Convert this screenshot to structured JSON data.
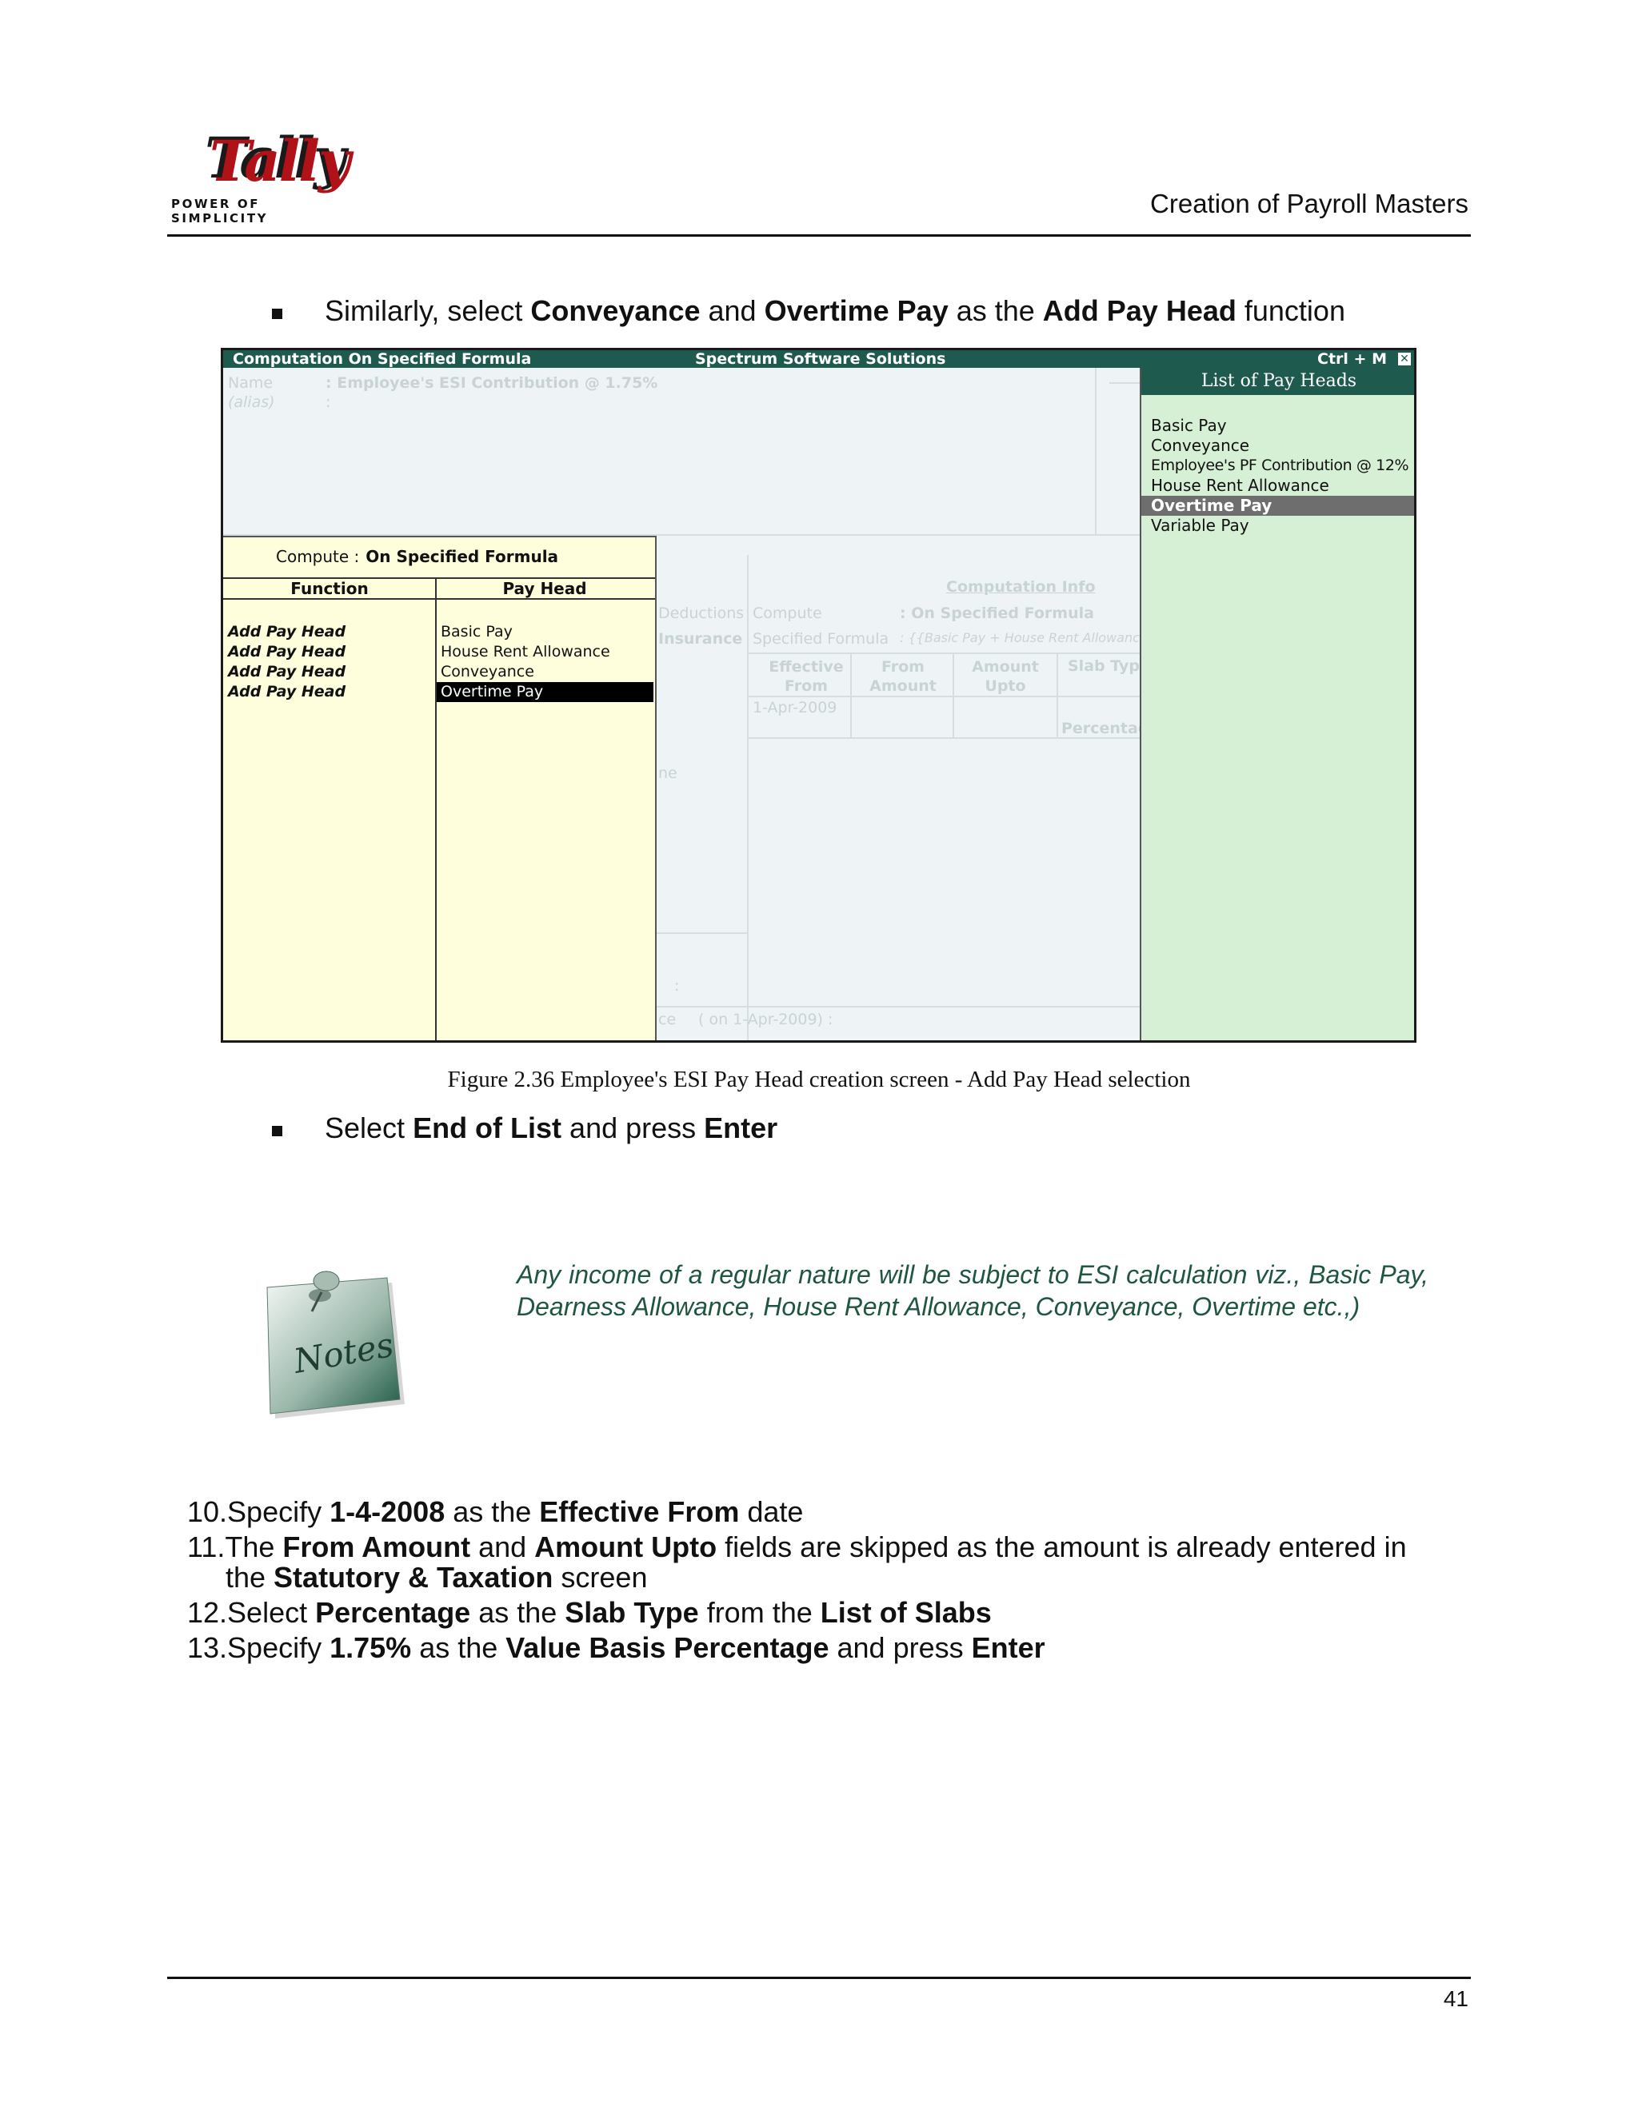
{
  "header": {
    "logo_word": "Tally",
    "logo_tagline": "POWER OF SIMPLICITY",
    "chapter_title": "Creation of Payroll Masters"
  },
  "bullet1": {
    "t1": "Similarly, select ",
    "b1": "Conveyance",
    "t2": " and ",
    "b2": "Overtime Pay",
    "t3": " as the ",
    "b3": "Add Pay Head",
    "t4": " function"
  },
  "screenshot": {
    "title_left": "Computation On Specified Formula",
    "title_center": "Spectrum Software Solutions",
    "title_right": "Ctrl + M",
    "close_glyph": "✕",
    "background": {
      "name_label": "Name",
      "name_value": ":  Employee's ESI Contribution @ 1.75%",
      "alias_label": "(alias)",
      "alias_colon": ":",
      "deductions": "Deductions",
      "insurance": "Insurance",
      "computation_info": "Computation Info",
      "compute_label": "Compute",
      "compute_value": ":  On Specified Formula",
      "specified_formula_label": "Specified Formula",
      "specified_formula_value": ":  {{Basic Pay + House Rent Allowance} + Co",
      "col_effective_from": "Effective From",
      "col_from_amount": "From Amount",
      "col_amount_upto": "Amount Upto",
      "col_slab_type": "Slab Typ",
      "row_date": "1-Apr-2009",
      "row_slab": "Percentag",
      "frag_ne": "ne",
      "frag_colon": ":",
      "frag_ce": "ce",
      "frag_on_date": "( on 1-Apr-2009)  :"
    },
    "formula_panel": {
      "compute_label": "Compute :",
      "compute_value": "On Specified Formula",
      "col_function": "Function",
      "col_pay_head": "Pay Head",
      "rows": [
        {
          "function": "Add Pay Head",
          "pay_head": "Basic Pay"
        },
        {
          "function": "Add Pay Head",
          "pay_head": "House Rent Allowance"
        },
        {
          "function": "Add Pay Head",
          "pay_head": "Conveyance"
        },
        {
          "function": "Add Pay Head",
          "pay_head": "Overtime Pay"
        }
      ],
      "selected_index": 3
    },
    "pay_heads_list": {
      "title": "List of Pay Heads",
      "items": [
        "Basic Pay",
        "Conveyance",
        "Employee's PF Contribution @ 12%",
        "House Rent Allowance",
        "Overtime Pay",
        "Variable Pay"
      ],
      "selected_index": 4
    }
  },
  "figure_caption": "Figure 2.36  Employee's ESI Pay Head creation screen - Add Pay Head selection",
  "bullet2": {
    "t1": "Select ",
    "b1": "End of List",
    "t2": " and press ",
    "b2": "Enter"
  },
  "note": {
    "icon_label": "Notes",
    "text": "Any income of a regular nature will be subject to ESI calculation viz., Basic Pay, Dearness Allowance, House Rent Allowance, Conveyance, Overtime etc.,)"
  },
  "steps": [
    {
      "n": "10.",
      "parts": [
        [
          "Specify ",
          false
        ],
        [
          "1-4-2008",
          true
        ],
        [
          " as the ",
          false
        ],
        [
          "Effective From",
          true
        ],
        [
          " date",
          false
        ]
      ]
    },
    {
      "n": "11.",
      "parts": [
        [
          "The ",
          false
        ],
        [
          "From Amount",
          true
        ],
        [
          " and ",
          false
        ],
        [
          "Amount Upto",
          true
        ],
        [
          " fields are skipped as the amount is already entered in",
          false
        ]
      ],
      "cont": [
        [
          "the ",
          false
        ],
        [
          "Statutory & Taxation",
          true
        ],
        [
          " screen",
          false
        ]
      ]
    },
    {
      "n": "12.",
      "parts": [
        [
          "Select ",
          false
        ],
        [
          "Percentage",
          true
        ],
        [
          " as the ",
          false
        ],
        [
          "Slab Type",
          true
        ],
        [
          " from the ",
          false
        ],
        [
          "List of Slabs",
          true
        ]
      ]
    },
    {
      "n": "13.",
      "parts": [
        [
          "Specify ",
          false
        ],
        [
          "1.75%",
          true
        ],
        [
          " as the ",
          false
        ],
        [
          "Value Basis Percentage",
          true
        ],
        [
          " and press ",
          false
        ],
        [
          "Enter",
          true
        ]
      ]
    }
  ],
  "page_number": "41",
  "colors": {
    "titlebar": "#1f5a4e",
    "formula_panel": "#fefedc",
    "pay_heads_panel": "#d6f0d6",
    "note_text": "#1e5640"
  }
}
